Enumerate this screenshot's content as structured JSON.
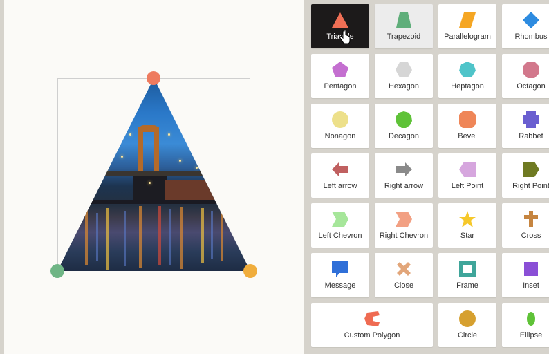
{
  "panel": {
    "shapes": [
      {
        "label": "Triangle",
        "icon": "triangle-icon",
        "color": "#ef6f55",
        "state": "active"
      },
      {
        "label": "Trapezoid",
        "icon": "trapezoid-icon",
        "color": "#5fae7a",
        "state": "hover"
      },
      {
        "label": "Parallelogram",
        "icon": "parallelogram-icon",
        "color": "#f5a623",
        "state": ""
      },
      {
        "label": "Rhombus",
        "icon": "rhombus-icon",
        "color": "#2d8be0",
        "state": ""
      },
      {
        "label": "Pentagon",
        "icon": "pentagon-icon",
        "color": "#c46fd0",
        "state": ""
      },
      {
        "label": "Hexagon",
        "icon": "hexagon-icon",
        "color": "#d6d6d6",
        "state": ""
      },
      {
        "label": "Heptagon",
        "icon": "heptagon-icon",
        "color": "#4fc4c9",
        "state": ""
      },
      {
        "label": "Octagon",
        "icon": "octagon-icon",
        "color": "#d2788c",
        "state": ""
      },
      {
        "label": "Nonagon",
        "icon": "nonagon-icon",
        "color": "#ede08a",
        "state": ""
      },
      {
        "label": "Decagon",
        "icon": "decagon-icon",
        "color": "#5fc238",
        "state": ""
      },
      {
        "label": "Bevel",
        "icon": "bevel-icon",
        "color": "#ef8658",
        "state": ""
      },
      {
        "label": "Rabbet",
        "icon": "rabbet-icon",
        "color": "#6a5fd0",
        "state": ""
      },
      {
        "label": "Left arrow",
        "icon": "left-arrow-icon",
        "color": "#c06060",
        "state": ""
      },
      {
        "label": "Right arrow",
        "icon": "right-arrow-icon",
        "color": "#8a8a8a",
        "state": ""
      },
      {
        "label": "Left Point",
        "icon": "left-point-icon",
        "color": "#d6a6de",
        "state": ""
      },
      {
        "label": "Right Point",
        "icon": "right-point-icon",
        "color": "#6f7a22",
        "state": ""
      },
      {
        "label": "Left Chevron",
        "icon": "left-chevron-icon",
        "color": "#a6e69a",
        "state": ""
      },
      {
        "label": "Right Chevron",
        "icon": "right-chevron-icon",
        "color": "#f2a083",
        "state": ""
      },
      {
        "label": "Star",
        "icon": "star-icon",
        "color": "#f6c82a",
        "state": ""
      },
      {
        "label": "Cross",
        "icon": "cross-icon",
        "color": "#c68540",
        "state": ""
      },
      {
        "label": "Message",
        "icon": "message-icon",
        "color": "#2f6fd8",
        "state": ""
      },
      {
        "label": "Close",
        "icon": "close-icon",
        "color": "#e2a67a",
        "state": ""
      },
      {
        "label": "Frame",
        "icon": "frame-icon",
        "color": "#3fa59a",
        "state": ""
      },
      {
        "label": "Inset",
        "icon": "inset-icon",
        "color": "#8a4fd6",
        "state": ""
      },
      {
        "label": "Custom Polygon",
        "icon": "custom-polygon-icon",
        "color": "#ef6b52",
        "state": "",
        "wide": true
      },
      {
        "label": "Circle",
        "icon": "circle-icon",
        "color": "#d6a02f",
        "state": ""
      },
      {
        "label": "Ellipse",
        "icon": "ellipse-icon",
        "color": "#5fc238",
        "state": ""
      }
    ]
  },
  "canvas": {
    "selected_shape": "Triangle",
    "handle_colors": {
      "top": "#ee7b5f",
      "left": "#6fb585",
      "right": "#f0ad3c"
    }
  }
}
